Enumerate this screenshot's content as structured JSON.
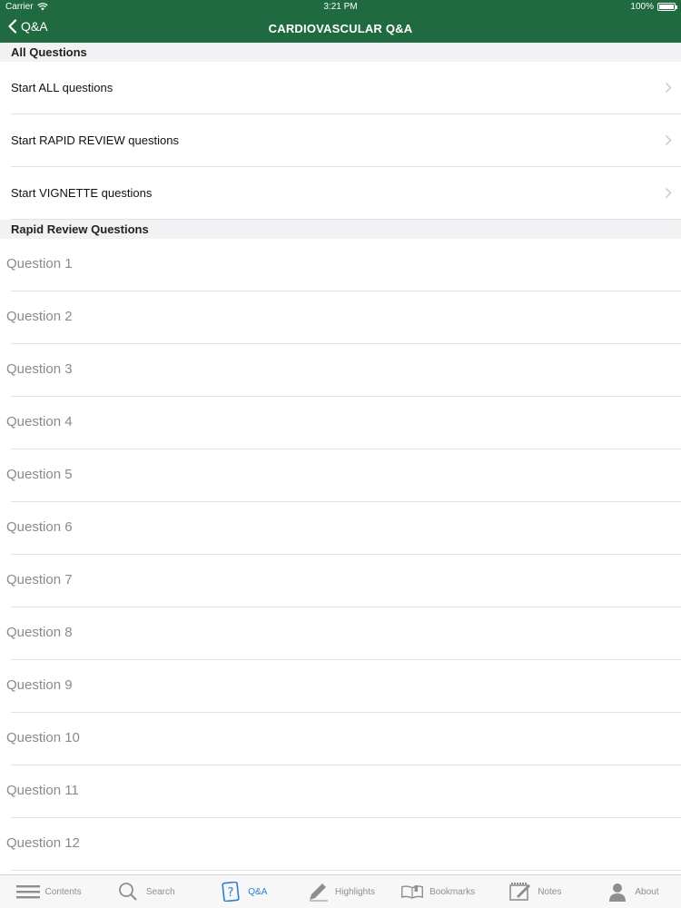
{
  "status_bar": {
    "carrier": "Carrier",
    "time": "3:21 PM",
    "battery": "100%",
    "battery_level": 1.0
  },
  "nav": {
    "back_label": "Q&A",
    "title": "CARDIOVASCULAR Q&A"
  },
  "sections": {
    "all": {
      "header": "All Questions",
      "items": [
        {
          "label": "Start ALL questions"
        },
        {
          "label": "Start RAPID REVIEW questions"
        },
        {
          "label": "Start VIGNETTE questions"
        }
      ]
    },
    "rapid": {
      "header": "Rapid Review Questions",
      "items": [
        {
          "label": "Question 1"
        },
        {
          "label": "Question 2"
        },
        {
          "label": "Question 3"
        },
        {
          "label": "Question 4"
        },
        {
          "label": "Question 5"
        },
        {
          "label": "Question 6"
        },
        {
          "label": "Question 7"
        },
        {
          "label": "Question 8"
        },
        {
          "label": "Question 9"
        },
        {
          "label": "Question 10"
        },
        {
          "label": "Question 11"
        },
        {
          "label": "Question 12"
        }
      ]
    }
  },
  "tabbar": {
    "items": [
      {
        "label": "Contents",
        "icon": "list-icon"
      },
      {
        "label": "Search",
        "icon": "search-icon"
      },
      {
        "label": "Q&A",
        "icon": "question-icon",
        "active": true
      },
      {
        "label": "Highlights",
        "icon": "pencil-icon"
      },
      {
        "label": "Bookmarks",
        "icon": "book-icon"
      },
      {
        "label": "Notes",
        "icon": "note-icon"
      },
      {
        "label": "About",
        "icon": "person-icon"
      }
    ]
  },
  "colors": {
    "header_green": "#1f6b3f",
    "active_tab": "#2a7fd4",
    "inactive_tab": "#8e8e8e",
    "question_text": "#8a8a8a"
  }
}
